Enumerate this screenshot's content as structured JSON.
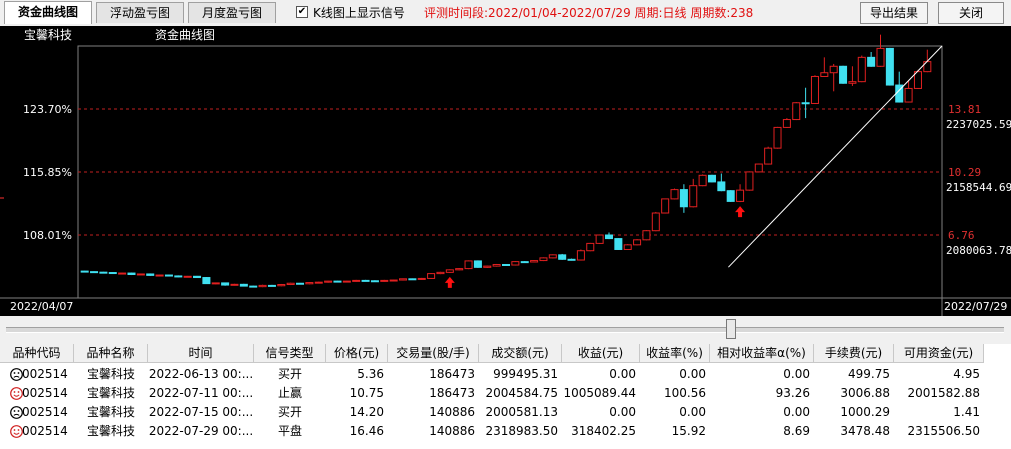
{
  "tabs": [
    {
      "label": "资金曲线图",
      "active": true
    },
    {
      "label": "浮动盈亏图",
      "active": false
    },
    {
      "label": "月度盈亏图",
      "active": false
    }
  ],
  "kline_checkbox": {
    "label": "K线图上显示信号",
    "checked": true
  },
  "eval_info": "评测时间段:2022/01/04-2022/07/29  周期:日线  周期数:238",
  "buttons": {
    "export": "导出结果",
    "close": "关闭"
  },
  "chart": {
    "stock_name": "宝馨科技",
    "title": "资金曲线图",
    "left_axis_labels": [
      "123.70%",
      "115.85%",
      "108.01%"
    ],
    "right_price_labels": [
      "13.81",
      "10.29",
      "6.76"
    ],
    "right_equity_labels": [
      "2237025.59",
      "2158544.69",
      "2080063.78"
    ],
    "start_date": "2022/04/07",
    "end_date": "2022/07/29",
    "colors": {
      "up": "#e02020",
      "down": "#40e0f0",
      "grid": "#c02020",
      "line": "#ffffff"
    }
  },
  "chart_data": {
    "type": "candlestick",
    "price_levels": [
      6.76,
      10.29,
      13.81
    ],
    "equity_levels": [
      2080063.78,
      2158544.69,
      2237025.59
    ],
    "return_levels_pct": [
      108.01,
      115.85,
      123.7
    ],
    "date_range": [
      "2022/04/07",
      "2022/07/29"
    ],
    "candles": [
      [
        4.74,
        4.71,
        4.76,
        4.68
      ],
      [
        4.71,
        4.68,
        4.73,
        4.65
      ],
      [
        4.68,
        4.66,
        4.7,
        4.63
      ],
      [
        4.66,
        4.61,
        4.68,
        4.58
      ],
      [
        4.61,
        4.63,
        4.65,
        4.58
      ],
      [
        4.63,
        4.55,
        4.66,
        4.52
      ],
      [
        4.55,
        4.58,
        4.6,
        4.52
      ],
      [
        4.58,
        4.5,
        4.61,
        4.47
      ],
      [
        4.5,
        4.52,
        4.55,
        4.47
      ],
      [
        4.52,
        4.47,
        4.55,
        4.44
      ],
      [
        4.47,
        4.42,
        4.5,
        4.39
      ],
      [
        4.42,
        4.45,
        4.47,
        4.39
      ],
      [
        4.45,
        4.38,
        4.47,
        4.36
      ],
      [
        4.38,
        4.04,
        4.41,
        4.02
      ],
      [
        4.04,
        4.08,
        4.1,
        4.0
      ],
      [
        4.08,
        3.96,
        4.1,
        3.92
      ],
      [
        3.96,
        4.0,
        4.03,
        3.93
      ],
      [
        4.0,
        3.9,
        4.03,
        3.88
      ],
      [
        3.9,
        3.87,
        3.93,
        3.85
      ],
      [
        3.87,
        3.94,
        3.98,
        3.84
      ],
      [
        3.94,
        3.92,
        3.97,
        3.89
      ],
      [
        3.92,
        3.99,
        4.02,
        3.89
      ],
      [
        3.99,
        4.06,
        4.09,
        3.96
      ],
      [
        4.06,
        4.03,
        4.08,
        4.0
      ],
      [
        4.03,
        4.1,
        4.13,
        4.0
      ],
      [
        4.1,
        4.12,
        4.15,
        4.07
      ],
      [
        4.12,
        4.18,
        4.2,
        4.09
      ],
      [
        4.18,
        4.15,
        4.2,
        4.12
      ],
      [
        4.15,
        4.18,
        4.2,
        4.12
      ],
      [
        4.18,
        4.22,
        4.25,
        4.15
      ],
      [
        4.22,
        4.2,
        4.25,
        4.17
      ],
      [
        4.2,
        4.17,
        4.23,
        4.15
      ],
      [
        4.17,
        4.22,
        4.25,
        4.15
      ],
      [
        4.22,
        4.24,
        4.26,
        4.19
      ],
      [
        4.24,
        4.31,
        4.33,
        4.21
      ],
      [
        4.31,
        4.29,
        4.33,
        4.26
      ],
      [
        4.29,
        4.33,
        4.36,
        4.26
      ],
      [
        4.33,
        4.6,
        4.63,
        4.3
      ],
      [
        4.6,
        4.67,
        4.7,
        4.57
      ],
      [
        4.67,
        4.81,
        4.84,
        4.64
      ],
      [
        4.81,
        4.88,
        4.91,
        4.78
      ],
      [
        4.88,
        5.31,
        5.34,
        4.85
      ],
      [
        5.31,
        4.95,
        5.34,
        4.92
      ],
      [
        4.95,
        5.02,
        5.05,
        4.92
      ],
      [
        5.02,
        5.11,
        5.14,
        4.99
      ],
      [
        5.11,
        5.08,
        5.14,
        5.05
      ],
      [
        5.08,
        5.27,
        5.3,
        5.05
      ],
      [
        5.27,
        5.25,
        5.3,
        5.22
      ],
      [
        5.25,
        5.33,
        5.36,
        5.22
      ],
      [
        5.33,
        5.48,
        5.51,
        5.3
      ],
      [
        5.48,
        5.65,
        5.68,
        5.45
      ],
      [
        5.65,
        5.4,
        5.7,
        5.37
      ],
      [
        5.4,
        5.36,
        5.44,
        5.33
      ],
      [
        5.36,
        5.88,
        5.95,
        5.33
      ],
      [
        5.88,
        6.29,
        6.32,
        5.85
      ],
      [
        6.29,
        6.76,
        6.79,
        6.26
      ],
      [
        6.76,
        6.56,
        6.9,
        6.53
      ],
      [
        6.56,
        5.95,
        6.59,
        5.92
      ],
      [
        5.95,
        6.21,
        6.25,
        5.92
      ],
      [
        6.21,
        6.49,
        6.53,
        6.18
      ],
      [
        6.49,
        7.0,
        7.03,
        6.46
      ],
      [
        7.0,
        7.99,
        8.05,
        6.97
      ],
      [
        7.99,
        8.78,
        8.8,
        7.96
      ],
      [
        8.78,
        9.3,
        9.36,
        8.75
      ],
      [
        9.3,
        8.34,
        9.6,
        8.0
      ],
      [
        8.34,
        9.52,
        9.9,
        8.3
      ],
      [
        9.52,
        10.1,
        10.15,
        9.49
      ],
      [
        10.1,
        9.73,
        10.13,
        9.7
      ],
      [
        9.73,
        9.24,
        10.2,
        9.21
      ],
      [
        9.24,
        8.64,
        9.27,
        8.61
      ],
      [
        8.64,
        9.27,
        9.6,
        8.6
      ],
      [
        9.27,
        10.29,
        10.32,
        9.24
      ],
      [
        10.29,
        10.73,
        10.76,
        10.26
      ],
      [
        10.73,
        11.62,
        11.7,
        10.7
      ],
      [
        11.62,
        12.78,
        12.81,
        11.59
      ],
      [
        12.78,
        13.22,
        13.3,
        12.75
      ],
      [
        13.22,
        14.16,
        14.2,
        13.19
      ],
      [
        14.16,
        14.12,
        15.0,
        13.3
      ],
      [
        14.12,
        15.63,
        15.7,
        14.09
      ],
      [
        15.63,
        15.84,
        16.7,
        15.6
      ],
      [
        15.84,
        16.2,
        16.33,
        14.8
      ],
      [
        16.2,
        15.25,
        16.23,
        15.22
      ],
      [
        15.25,
        15.34,
        16.2,
        15.1
      ],
      [
        15.34,
        16.7,
        16.8,
        15.31
      ],
      [
        16.7,
        16.2,
        17.0,
        16.17
      ],
      [
        16.2,
        17.2,
        17.97,
        16.17
      ],
      [
        17.2,
        15.15,
        17.23,
        15.12
      ],
      [
        15.15,
        14.2,
        15.9,
        14.17
      ],
      [
        14.2,
        14.96,
        15.4,
        14.17
      ],
      [
        14.96,
        15.9,
        16.0,
        14.93
      ],
      [
        15.9,
        16.46,
        17.13,
        15.87
      ]
    ],
    "signals": [
      {
        "type": "买开",
        "index": 39
      },
      {
        "type": "买开",
        "index": 70
      }
    ],
    "equity_line_points": [
      [
        "2022/07/01",
        2040000
      ],
      [
        "2022/07/29",
        2327000
      ]
    ]
  },
  "table": {
    "columns": [
      "品种代码",
      "品种名称",
      "时间",
      "信号类型",
      "价格(元)",
      "交易量(股/手)",
      "成交额(元)",
      "收益(元)",
      "收益率(%)",
      "相对收益率α(%)",
      "手续费(元)",
      "可用资金(元)"
    ],
    "rows": [
      {
        "face": "neutral",
        "code": "002514",
        "name": "宝馨科技",
        "time": "2022-06-13 00:...",
        "signal": "买开",
        "price": "5.36",
        "volume": "186473",
        "amount": "999495.31",
        "profit": "0.00",
        "rate": "0.00",
        "alpha": "0.00",
        "fee": "499.75",
        "cash": "4.95"
      },
      {
        "face": "happy",
        "code": "002514",
        "name": "宝馨科技",
        "time": "2022-07-11 00:...",
        "signal": "止赢",
        "price": "10.75",
        "volume": "186473",
        "amount": "2004584.75",
        "profit": "1005089.44",
        "rate": "100.56",
        "alpha": "93.26",
        "fee": "3006.88",
        "cash": "2001582.88"
      },
      {
        "face": "neutral",
        "code": "002514",
        "name": "宝馨科技",
        "time": "2022-07-15 00:...",
        "signal": "买开",
        "price": "14.20",
        "volume": "140886",
        "amount": "2000581.13",
        "profit": "0.00",
        "rate": "0.00",
        "alpha": "0.00",
        "fee": "1000.29",
        "cash": "1.41"
      },
      {
        "face": "happy",
        "code": "002514",
        "name": "宝馨科技",
        "time": "2022-07-29 00:...",
        "signal": "平盘",
        "price": "16.46",
        "volume": "140886",
        "amount": "2318983.50",
        "profit": "318402.25",
        "rate": "15.92",
        "alpha": "8.69",
        "fee": "3478.48",
        "cash": "2315506.50"
      }
    ]
  }
}
